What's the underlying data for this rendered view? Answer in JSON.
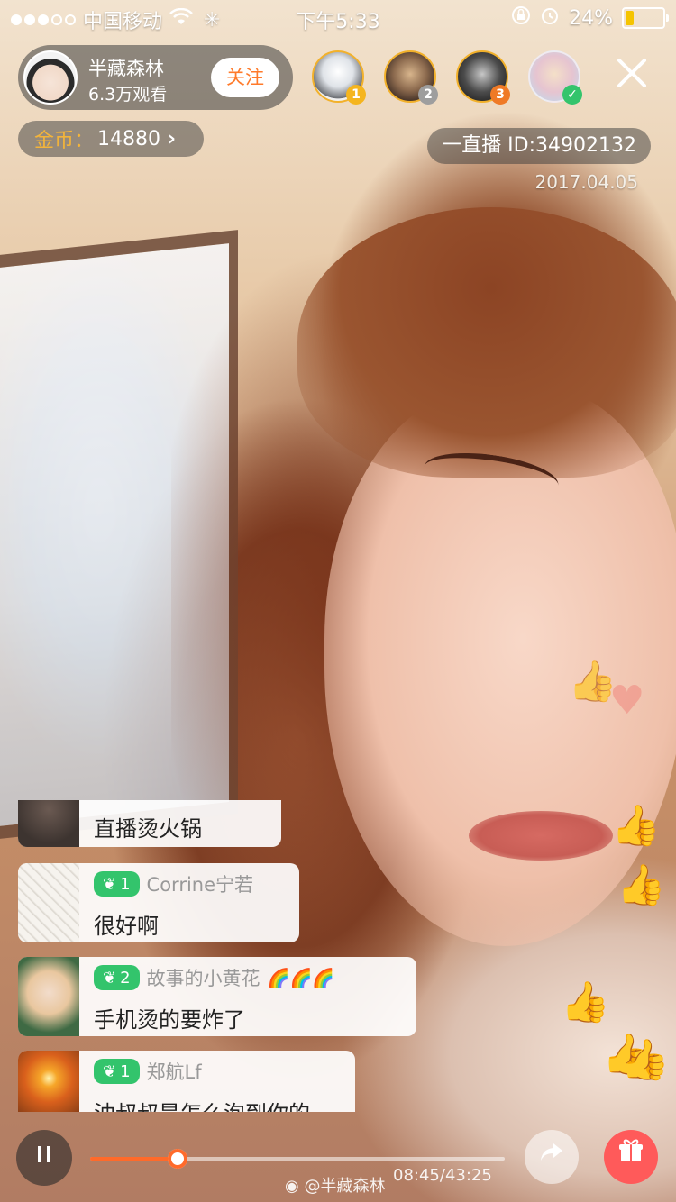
{
  "status_bar": {
    "carrier": "中国移动",
    "time": "下午5:33",
    "battery_percent": "24%",
    "battery_level": 0.24
  },
  "host": {
    "name": "半藏森林",
    "viewers": "6.3万观看",
    "follow_label": "关注"
  },
  "top_viewers": [
    {
      "rank": "1",
      "badge_color": "#f5b51e"
    },
    {
      "rank": "2",
      "badge_color": "#9e9e9e"
    },
    {
      "rank": "3",
      "badge_color": "#ef7a26"
    },
    {
      "rank": "✓",
      "badge_color": "#33c46c"
    }
  ],
  "coins": {
    "label": "金币：",
    "value": "14880",
    "chevron": "›"
  },
  "stream": {
    "id": "一直播 ID:34902132",
    "date": "2017.04.05"
  },
  "chat": [
    {
      "level": "",
      "user": "",
      "message": "直播烫火锅"
    },
    {
      "level": "1",
      "user": "Corrine宁若",
      "message": "很好啊"
    },
    {
      "level": "2",
      "user": "故事的小黄花",
      "message": "手机烫的要炸了",
      "emoji": "🌈🌈🌈"
    },
    {
      "level": "1",
      "user": "郑航Lf",
      "message": "油叔叔是怎么泡到你的"
    }
  ],
  "player": {
    "progress": 0.21,
    "time": "08:45/43:25",
    "watermark": "@半藏森林"
  },
  "colors": {
    "accent": "#ff6a2a",
    "level_green": "#33c46c",
    "coin_gold": "#f3b43a",
    "gift_red": "#ff5a5a"
  }
}
